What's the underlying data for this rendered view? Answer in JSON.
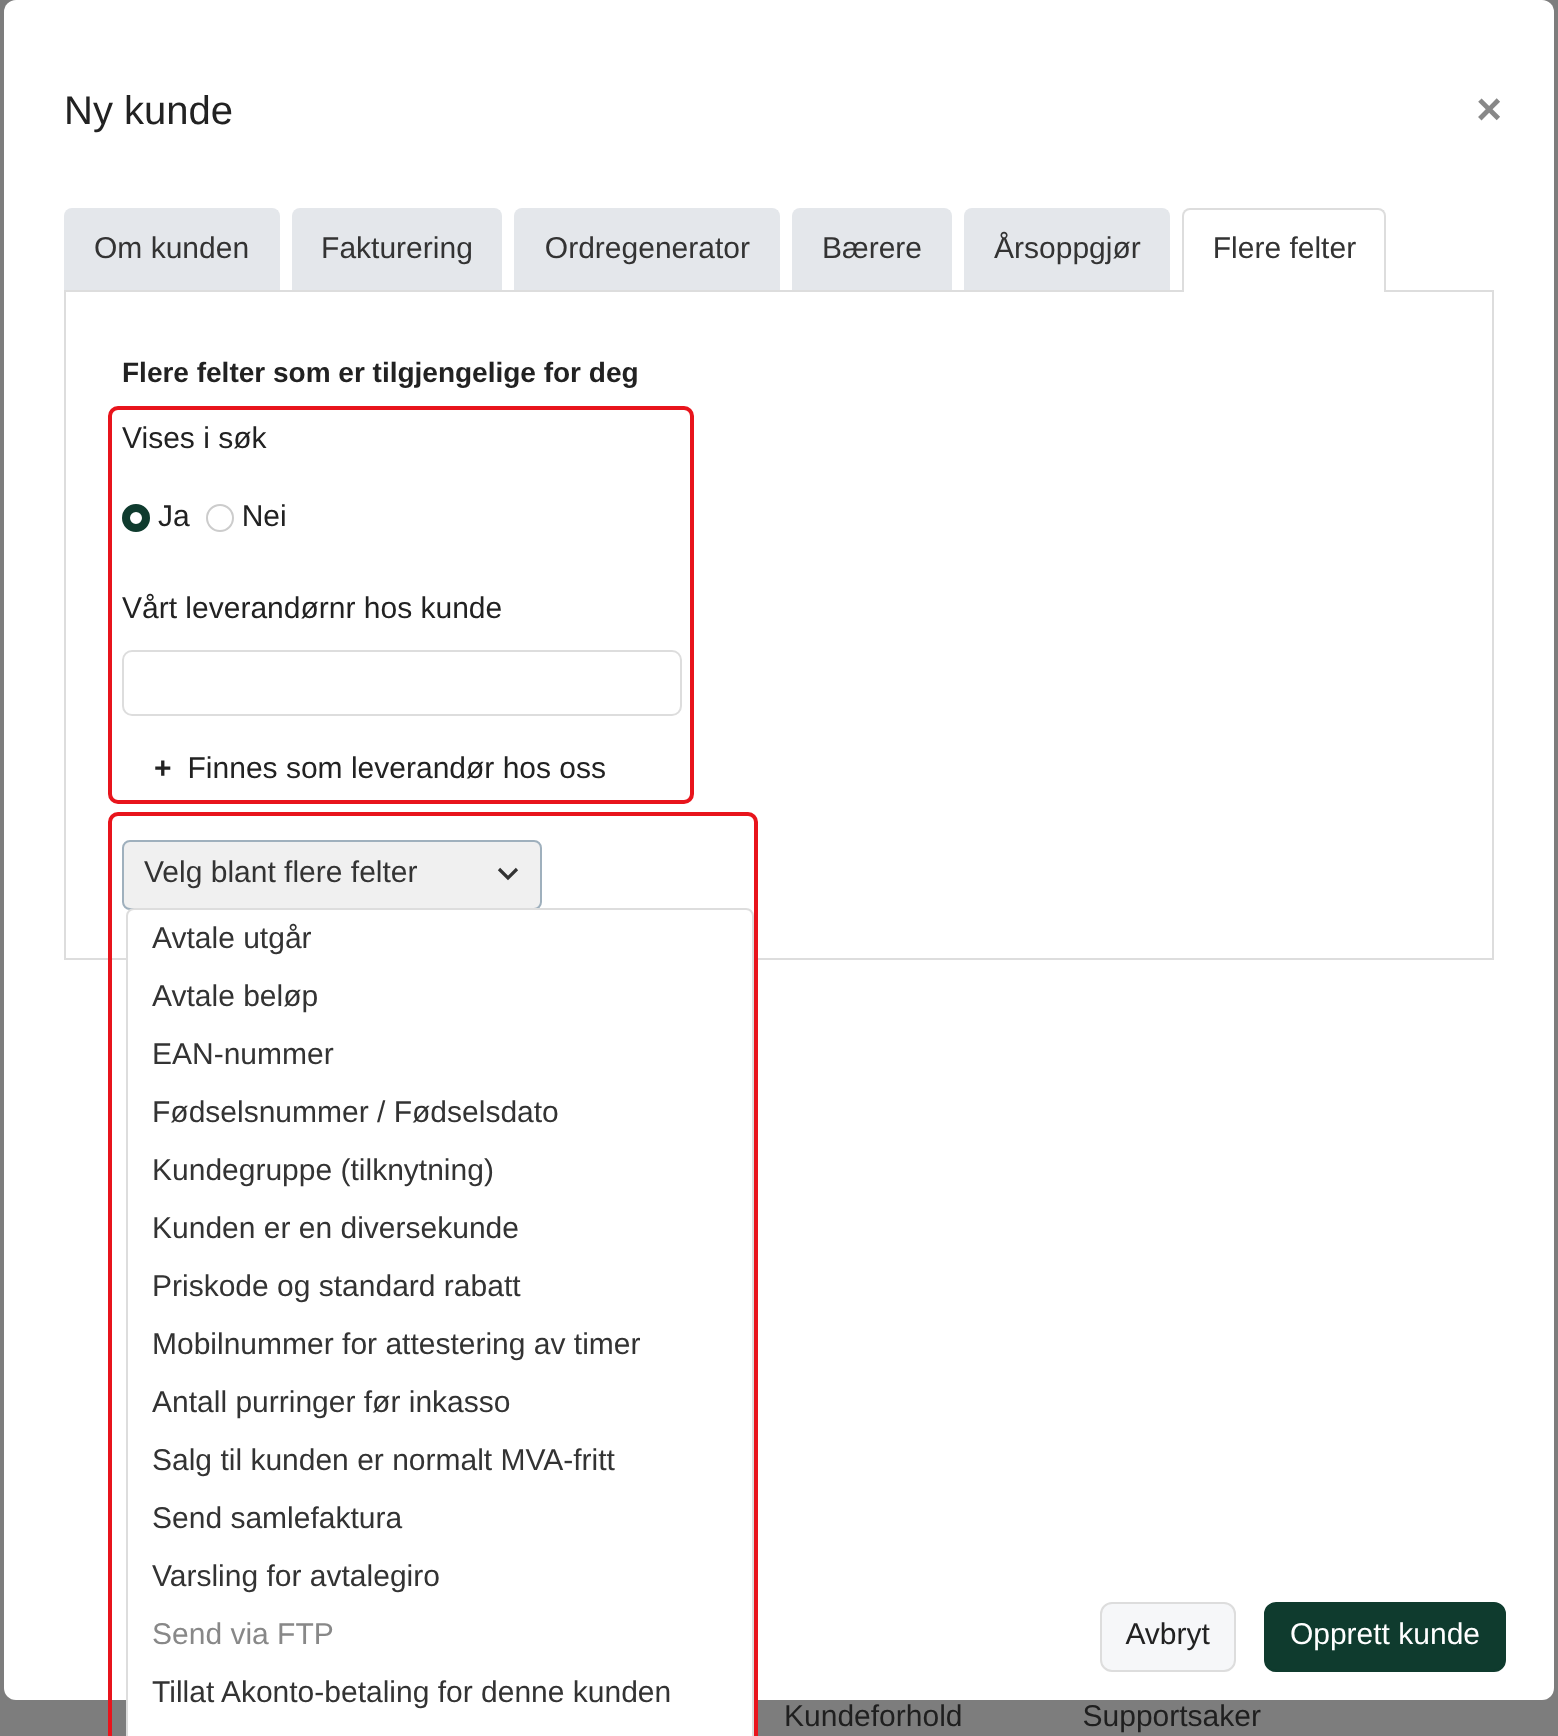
{
  "dialog": {
    "title": "Ny kunde",
    "close": "×",
    "tabs": [
      {
        "label": "Om kunden",
        "selected": false
      },
      {
        "label": "Fakturering",
        "selected": false
      },
      {
        "label": "Ordregenerator",
        "selected": false
      },
      {
        "label": "Bærere",
        "selected": false
      },
      {
        "label": "Årsoppgjør",
        "selected": false
      },
      {
        "label": "Flere felter",
        "selected": true
      }
    ],
    "section_title": "Flere felter som er tilgjengelige for deg",
    "visible_in_search": {
      "label": "Vises i søk",
      "options": [
        {
          "label": "Ja",
          "selected": true
        },
        {
          "label": "Nei",
          "selected": false
        }
      ]
    },
    "supplier_number": {
      "label": "Vårt leverandørnr hos kunde"
    },
    "add_link": {
      "icon": "+",
      "label": "Finnes som leverandør hos oss"
    },
    "field_picker": {
      "label": "Velg blant flere felter",
      "expanded": true,
      "options": [
        {
          "label": "Avtale utgår",
          "disabled": false
        },
        {
          "label": "Avtale beløp",
          "disabled": false
        },
        {
          "label": "EAN-nummer",
          "disabled": false
        },
        {
          "label": "Fødselsnummer / Fødselsdato",
          "disabled": false
        },
        {
          "label": "Kundegruppe (tilknytning)",
          "disabled": false
        },
        {
          "label": "Kunden er en diversekunde",
          "disabled": false
        },
        {
          "label": "Priskode og standard rabatt",
          "disabled": false
        },
        {
          "label": "Mobilnummer for attestering av timer",
          "disabled": false
        },
        {
          "label": "Antall purringer før inkasso",
          "disabled": false
        },
        {
          "label": "Salg til kunden er normalt MVA-fritt",
          "disabled": false
        },
        {
          "label": "Send samlefaktura",
          "disabled": false
        },
        {
          "label": "Varsling for avtalegiro",
          "disabled": false
        },
        {
          "label": "Send via FTP",
          "disabled": true
        },
        {
          "label": "Tillat Akonto-betaling for denne kunden",
          "disabled": false
        }
      ]
    },
    "buttons": [
      {
        "label": "Avbryt",
        "kind": "secondary"
      },
      {
        "label": "Opprett kunde",
        "kind": "primary"
      }
    ]
  },
  "background": {
    "items": [
      "Kundeforhold",
      "Supportsaker"
    ]
  }
}
